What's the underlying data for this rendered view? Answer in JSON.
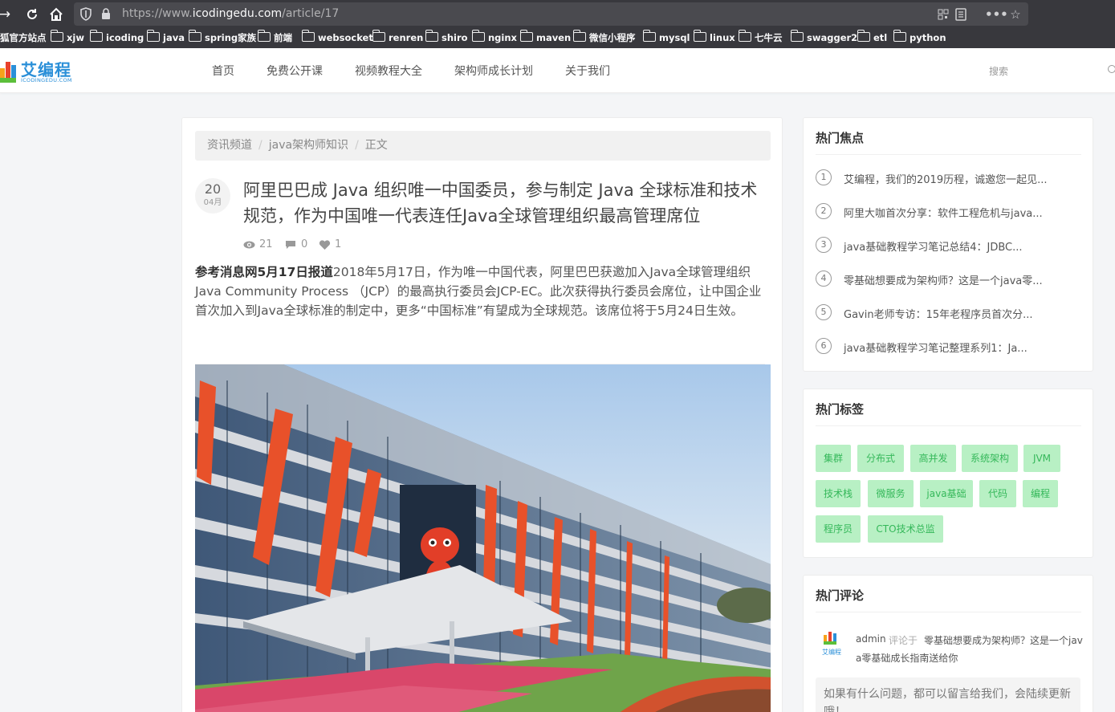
{
  "browser": {
    "url_prefix": "https://www.",
    "url_host": "icodingedu.com",
    "url_path": "/article/17",
    "bookmarks": [
      "狐官方站点",
      "xjw",
      "icoding",
      "java",
      "spring家族",
      "前端",
      "websocket",
      "renren",
      "shiro",
      "nginx",
      "maven",
      "微信小程序",
      "mysql",
      "linux",
      "七牛云",
      "swagger2",
      "etl",
      "python"
    ]
  },
  "site": {
    "logo_text": "艾编程",
    "logo_sub": "ICODINGEDU.COM",
    "menu": [
      "首页",
      "免费公开课",
      "视频教程大全",
      "架构师成长计划",
      "关于我们"
    ],
    "search_placeholder": "搜索"
  },
  "article": {
    "breadcrumb": [
      "资讯频道",
      "java架构师知识",
      "正文"
    ],
    "date_day": "20",
    "date_month": "04月",
    "title": "阿里巴巴成 Java 组织唯一中国委员，参与制定 Java 全球标准和技术规范，作为中国唯一代表连任Java全球管理组织最高管理席位",
    "views": "21",
    "comments": "0",
    "likes": "1",
    "lead_bold": "参考消息网5月17日报道",
    "lead_text": "2018年5月17日，作为唯一中国代表，阿里巴巴获邀加入Java全球管理组织Java Community Process （JCP）的最高执行委员会JCP-EC。此次获得执行委员会席位，让中国企业首次加入到Java全球标准的制定中，更多“中国标准”有望成为全球规范。该席位将于5月24日生效。"
  },
  "sidebar": {
    "hot_title": "热门焦点",
    "hot_items": [
      {
        "num": "1",
        "text": "艾编程，我们的2019历程，诚邀您一起见..."
      },
      {
        "num": "2",
        "text": "阿里大咖首次分享：软件工程危机与java..."
      },
      {
        "num": "3",
        "text": "java基础教程学习笔记总结4：JDBC..."
      },
      {
        "num": "4",
        "text": "零基础想要成为架构师？这是一个java零..."
      },
      {
        "num": "5",
        "text": "Gavin老师专访：15年老程序员首次分..."
      },
      {
        "num": "6",
        "text": "java基础教程学习笔记整理系列1：Ja..."
      }
    ],
    "tags_title": "热门标签",
    "tags": [
      "集群",
      "分布式",
      "高并发",
      "系统架构",
      "JVM",
      "技术栈",
      "微服务",
      "java基础",
      "代码",
      "编程",
      "程序员",
      "CTO技术总监"
    ],
    "comments_title": "热门评论",
    "comment_author": "admin",
    "comment_on": "评论于",
    "comment_post_line1": "零基础想要成为架构师？这是一个jav",
    "comment_post_line2": "a零基础成长指南送给你",
    "comment_body": "如果有什么问题，都可以留言给我们，会陆续更新哦！"
  },
  "colors": {
    "accent": "#2a8fd8",
    "tag_bg": "#b8f0c4",
    "tag_text": "#35b85a"
  }
}
